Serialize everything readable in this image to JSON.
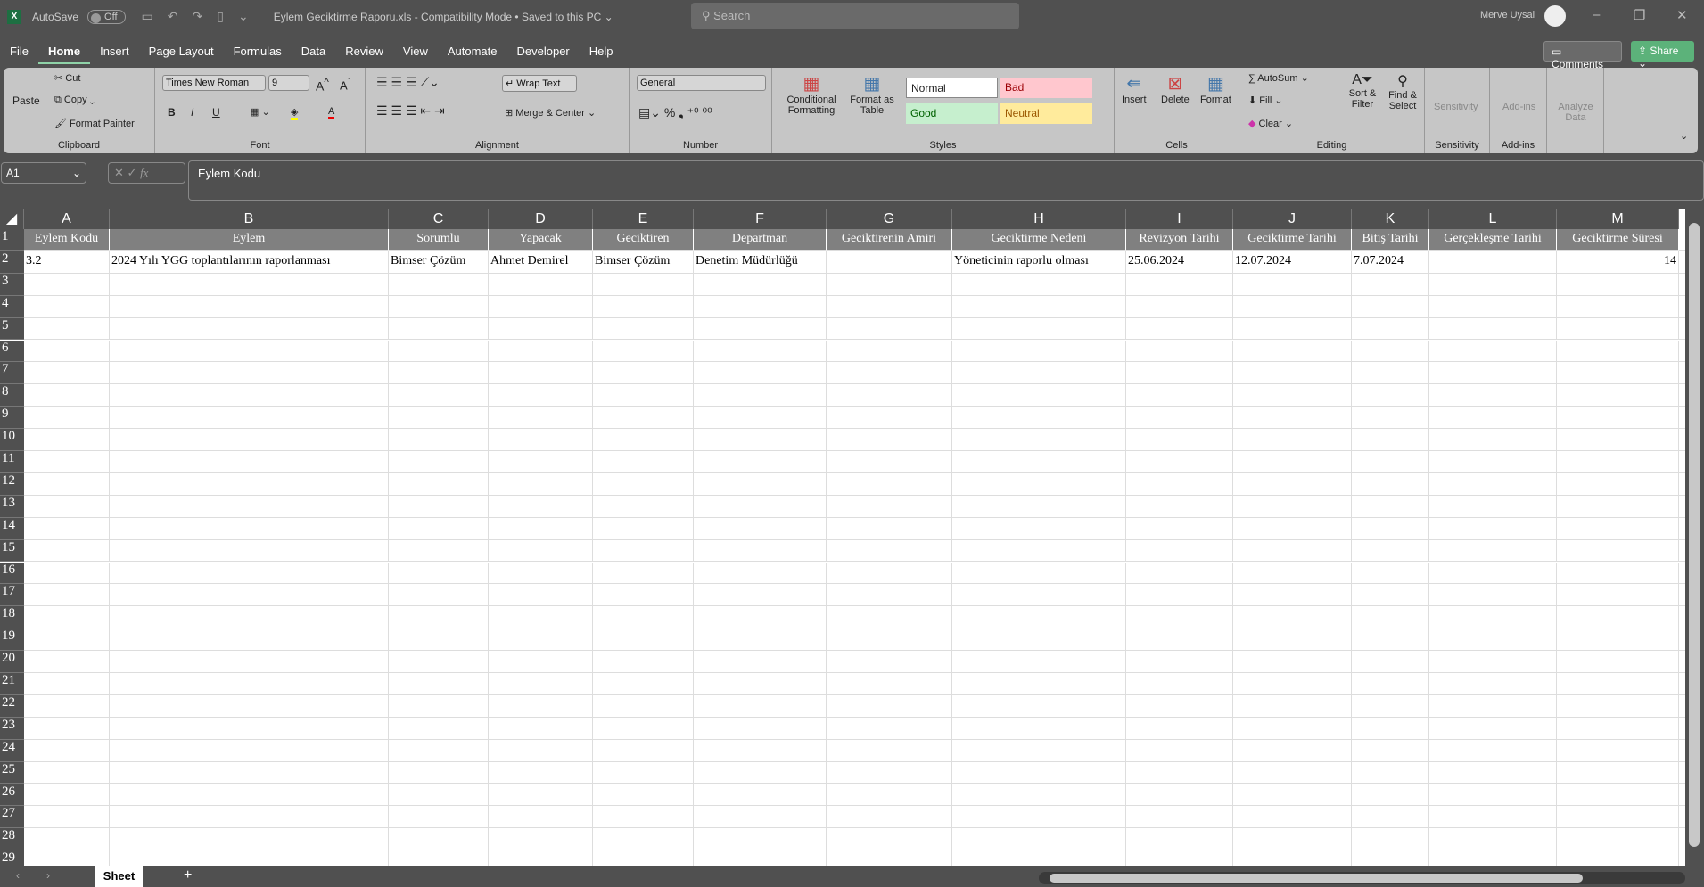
{
  "titlebar": {
    "autosave": "AutoSave",
    "autosave_state": "Off",
    "doc_title": "Eylem Geciktirme Raporu.xls  -  Compatibility Mode  •  Saved to this PC ⌄",
    "search_placeholder": "Search",
    "user": "Merve Uysal"
  },
  "menu": [
    "File",
    "Home",
    "Insert",
    "Page Layout",
    "Formulas",
    "Data",
    "Review",
    "View",
    "Automate",
    "Developer",
    "Help"
  ],
  "menu_active": "Home",
  "actions": {
    "comments": "Comments",
    "share": "Share"
  },
  "ribbon": {
    "clipboard": {
      "label": "Clipboard",
      "paste": "Paste",
      "cut": "Cut",
      "copy": "Copy",
      "format_painter": "Format Painter"
    },
    "font": {
      "label": "Font",
      "family": "Times New Roman",
      "size": "9",
      "bold": "B",
      "italic": "I",
      "underline": "U"
    },
    "alignment": {
      "label": "Alignment",
      "wrap": "Wrap Text",
      "merge": "Merge & Center"
    },
    "number": {
      "label": "Number",
      "format": "General"
    },
    "styles": {
      "label": "Styles",
      "conditional": "Conditional Formatting",
      "format_table": "Format as Table",
      "normal": "Normal",
      "bad": "Bad",
      "good": "Good",
      "neutral": "Neutral"
    },
    "cells": {
      "label": "Cells",
      "insert": "Insert",
      "delete": "Delete",
      "format": "Format"
    },
    "editing": {
      "label": "Editing",
      "autosum": "AutoSum",
      "fill": "Fill",
      "clear": "Clear",
      "sort": "Sort & Filter",
      "find": "Find & Select"
    },
    "sensitivity": {
      "label": "Sensitivity",
      "btn": "Sensitivity"
    },
    "addins": {
      "label": "Add-ins",
      "btn": "Add-ins"
    },
    "analyze": {
      "btn": "Analyze Data"
    }
  },
  "formula_bar": {
    "name_box": "A1",
    "fx": "fx",
    "content": "Eylem Kodu"
  },
  "sheet": {
    "columns": [
      "A",
      "B",
      "C",
      "D",
      "E",
      "F",
      "G",
      "H",
      "I",
      "J",
      "K",
      "L",
      "M"
    ],
    "headers": [
      "Eylem Kodu",
      "Eylem",
      "Sorumlu",
      "Yapacak",
      "Geciktiren",
      "Departman",
      "Geciktirenin Amiri",
      "Geciktirme Nedeni",
      "Revizyon Tarihi",
      "Geciktirme Tarihi",
      "Bitiş Tarihi",
      "Gerçekleşme Tarihi",
      "Geciktirme Süresi"
    ],
    "rows": [
      [
        "3.2",
        "2024 Yılı YGG toplantılarının raporlanması",
        "Bimser Çözüm",
        "Ahmet Demirel",
        "Bimser Çözüm",
        "Denetim Müdürlüğü",
        "",
        "Yöneticinin raporlu olması",
        "25.06.2024",
        "12.07.2024",
        "7.07.2024",
        "",
        "14"
      ]
    ],
    "visible_rows": 29
  },
  "sheet_tabs": [
    "Sheet"
  ],
  "colors": {
    "ribbon": "#c6c6c6",
    "header_row": "#808080",
    "good": "#c6efce",
    "bad": "#ffc7ce",
    "neutral": "#ffeb9c",
    "share": "#5cb27a"
  }
}
